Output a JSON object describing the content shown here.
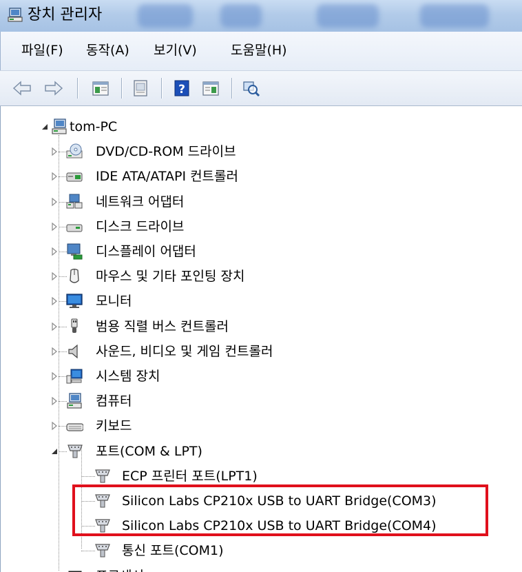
{
  "window": {
    "title": "장치 관리자"
  },
  "menu": [
    {
      "label": "파일(F)"
    },
    {
      "label": "동작(A)"
    },
    {
      "label": "보기(V)"
    },
    {
      "label": "도움말(H)"
    }
  ],
  "toolbar": [
    {
      "icon": "back-arrow-icon"
    },
    {
      "icon": "forward-arrow-icon"
    },
    {
      "icon": "show-hide-tree-icon"
    },
    {
      "icon": "properties-icon"
    },
    {
      "icon": "help-icon"
    },
    {
      "icon": "action-pane-icon"
    },
    {
      "icon": "scan-hardware-icon"
    }
  ],
  "tree": {
    "root": {
      "label": "tom-PC",
      "icon": "computer-icon",
      "expanded": true
    },
    "categories": [
      {
        "label": "DVD/CD-ROM 드라이브",
        "icon": "dvd-drive-icon"
      },
      {
        "label": "IDE ATA/ATAPI 컨트롤러",
        "icon": "ide-controller-icon"
      },
      {
        "label": "네트워크 어댑터",
        "icon": "network-adapter-icon"
      },
      {
        "label": "디스크 드라이브",
        "icon": "disk-drive-icon"
      },
      {
        "label": "디스플레이 어댑터",
        "icon": "display-adapter-icon"
      },
      {
        "label": "마우스 및 기타 포인팅 장치",
        "icon": "mouse-icon"
      },
      {
        "label": "모니터",
        "icon": "monitor-icon"
      },
      {
        "label": "범용 직렬 버스 컨트롤러",
        "icon": "usb-icon"
      },
      {
        "label": "사운드, 비디오 및 게임 컨트롤러",
        "icon": "speaker-icon"
      },
      {
        "label": "시스템 장치",
        "icon": "system-device-icon"
      },
      {
        "label": "컴퓨터",
        "icon": "computer-icon"
      },
      {
        "label": "키보드",
        "icon": "keyboard-icon"
      },
      {
        "label": "포트(COM & LPT)",
        "icon": "port-icon",
        "expanded": true,
        "children": [
          {
            "label": "ECP 프린터 포트(LPT1)",
            "icon": "port-icon"
          },
          {
            "label": "Silicon Labs CP210x USB to UART Bridge(COM3)",
            "icon": "port-icon",
            "highlighted": true
          },
          {
            "label": "Silicon Labs CP210x USB to UART Bridge(COM4)",
            "icon": "port-icon",
            "highlighted": true
          },
          {
            "label": "통신 포트(COM1)",
            "icon": "port-icon"
          }
        ]
      },
      {
        "label": "프로세서",
        "icon": "processor-icon"
      }
    ]
  },
  "colors": {
    "highlight_border": "#e0101c",
    "titlebar": "#b2cbe9"
  }
}
